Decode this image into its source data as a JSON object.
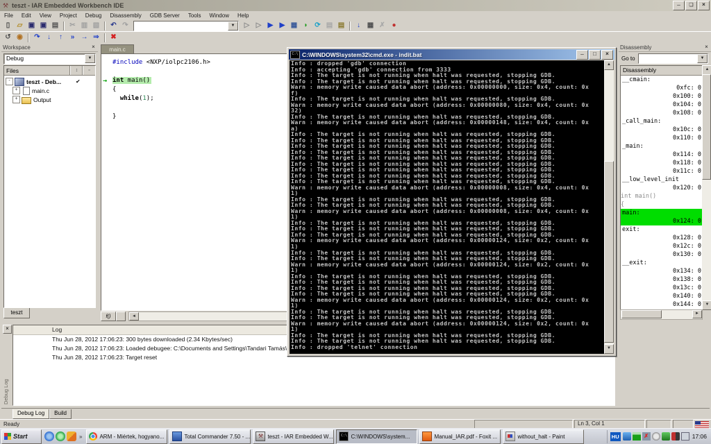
{
  "ide": {
    "title": "teszt - IAR Embedded Workbench IDE",
    "menus": [
      "File",
      "Edit",
      "View",
      "Project",
      "Debug",
      "Disassembly",
      "GDB Server",
      "Tools",
      "Window",
      "Help"
    ],
    "toolbar_main": [
      {
        "name": "new-file-icon",
        "glyph": "▯",
        "color": "#404040"
      },
      {
        "name": "open-file-icon",
        "glyph": "▱",
        "color": "#b08820"
      },
      {
        "name": "save-icon",
        "glyph": "▣",
        "color": "#2c2c6e"
      },
      {
        "name": "save-all-icon",
        "glyph": "▣",
        "color": "#2c2c6e"
      },
      {
        "name": "print-icon",
        "glyph": "▤",
        "color": "#555555"
      },
      {
        "type": "sep"
      },
      {
        "name": "cut-icon",
        "glyph": "✂",
        "color": "#a0a0a0"
      },
      {
        "name": "copy-icon",
        "glyph": "▥",
        "color": "#a0a0a0"
      },
      {
        "name": "paste-icon",
        "glyph": "▧",
        "color": "#a0a0a0"
      },
      {
        "type": "sep"
      },
      {
        "name": "undo-icon",
        "glyph": "↶",
        "color": "#28388c"
      },
      {
        "name": "redo-icon",
        "glyph": "↷",
        "color": "#a0a0a0"
      },
      {
        "type": "combo",
        "name": "quick-search-combo"
      },
      {
        "name": "nav-back-icon",
        "glyph": "▷",
        "color": "#8a8a8a"
      },
      {
        "name": "nav-forward-icon",
        "glyph": "▷",
        "color": "#8a8a8a"
      },
      {
        "name": "toggle-bookmark-icon",
        "glyph": "▶",
        "color": "#2040c8"
      },
      {
        "name": "go-to-bookmark-icon",
        "glyph": "▶",
        "color": "#2040c8"
      },
      {
        "name": "watch-window-icon",
        "glyph": "▦",
        "color": "#3a5a9a"
      },
      {
        "name": "make-icon",
        "glyph": "◗",
        "color": "#1a9a1a"
      },
      {
        "name": "compile-icon",
        "glyph": "⟳",
        "color": "#18a0c8"
      },
      {
        "name": "stop-build-icon",
        "glyph": "▤",
        "color": "#a8a8a8"
      },
      {
        "name": "build-log-icon",
        "glyph": "▤",
        "color": "#8a7a30"
      },
      {
        "type": "sep"
      },
      {
        "name": "download-icon",
        "glyph": "↓",
        "color": "#2040c8"
      },
      {
        "name": "registers-icon",
        "glyph": "▦",
        "color": "#505050"
      },
      {
        "name": "breakpoint-disabled-icon",
        "glyph": "✗",
        "color": "#a8a8a8"
      },
      {
        "name": "debug-icon",
        "glyph": "●",
        "color": "#c03030"
      }
    ],
    "toolbar_debug": [
      {
        "name": "reset-icon",
        "glyph": "↺",
        "color": "#505050"
      },
      {
        "name": "break-icon",
        "glyph": "◉",
        "color": "#b07020"
      },
      {
        "type": "sep"
      },
      {
        "name": "step-over-icon",
        "glyph": "↷",
        "color": "#2040c8"
      },
      {
        "name": "step-into-icon",
        "glyph": "↓",
        "color": "#2040c8"
      },
      {
        "name": "step-out-icon",
        "glyph": "↑",
        "color": "#2040c8"
      },
      {
        "name": "next-statement-icon",
        "glyph": "»",
        "color": "#2040c8"
      },
      {
        "name": "run-to-cursor-icon",
        "glyph": "→",
        "color": "#2040c8"
      },
      {
        "name": "go-icon",
        "glyph": "⇒",
        "color": "#2040c8"
      },
      {
        "type": "sep"
      },
      {
        "name": "stop-debugging-icon",
        "glyph": "✖",
        "color": "#d42020"
      }
    ],
    "workspace": {
      "title": "Workspace",
      "config": "Debug",
      "files_header": "Files",
      "tree": [
        {
          "label": "teszt - Deb...",
          "icon": "project",
          "expander": "-",
          "level": 0,
          "bold": true,
          "check": "✔"
        },
        {
          "label": "main.c",
          "icon": "file",
          "expander": "+",
          "level": 1
        },
        {
          "label": "Output",
          "icon": "folder",
          "expander": "+",
          "level": 1
        }
      ],
      "bottom_tab": "teszt"
    },
    "editor": {
      "tab": "main.c",
      "fn_label": "f()",
      "lines": [
        {
          "seg": [
            {
              "t": "#include",
              "c": "pre"
            },
            {
              "t": " <NXP/iolpc2106.h>",
              "c": "plain"
            }
          ]
        },
        {
          "seg": []
        },
        {
          "current": true,
          "seg": [
            {
              "t": "int",
              "c": "kw"
            },
            {
              "t": " main()",
              "c": "plain"
            }
          ]
        },
        {
          "seg": [
            {
              "t": "{",
              "c": "plain"
            }
          ]
        },
        {
          "seg": [
            {
              "t": "  ",
              "c": "plain"
            },
            {
              "t": "while",
              "c": "kw"
            },
            {
              "t": "(",
              "c": "plain"
            },
            {
              "t": "1",
              "c": "num"
            },
            {
              "t": ");",
              "c": "plain"
            }
          ]
        },
        {
          "seg": []
        },
        {
          "seg": [
            {
              "t": "}",
              "c": "plain"
            }
          ]
        }
      ]
    },
    "disassembly": {
      "title": "Disassembly",
      "goto_label": "Go to",
      "col_header": "Disassembly",
      "rows": [
        {
          "t": "__cmain:",
          "k": "label"
        },
        {
          "t": "0xfc: 0",
          "k": "addr"
        },
        {
          "t": "0x100: 0",
          "k": "addr"
        },
        {
          "t": "0x104: 0",
          "k": "addr"
        },
        {
          "t": "0x108: 0",
          "k": "addr"
        },
        {
          "t": "_call_main:",
          "k": "label"
        },
        {
          "t": "0x10c: 0",
          "k": "addr"
        },
        {
          "t": "0x110: 0",
          "k": "addr"
        },
        {
          "t": "_main:",
          "k": "label"
        },
        {
          "t": "0x114: 0",
          "k": "addr"
        },
        {
          "t": "0x118: 0",
          "k": "addr"
        },
        {
          "t": "0x11c: 0",
          "k": "addr"
        },
        {
          "t": "__low_level_init",
          "k": "label"
        },
        {
          "t": "0x120: 0",
          "k": "addr"
        },
        {
          "t": "int main()",
          "k": "src"
        },
        {
          "t": "{",
          "k": "src"
        },
        {
          "t": "main:",
          "k": "label cur"
        },
        {
          "t": "0x124: 0",
          "k": "addr cur"
        },
        {
          "t": "exit:",
          "k": "label"
        },
        {
          "t": "0x128: 0",
          "k": "addr"
        },
        {
          "t": "0x12c: 0",
          "k": "addr"
        },
        {
          "t": "0x130: 0",
          "k": "addr"
        },
        {
          "t": "__exit:",
          "k": "label"
        },
        {
          "t": "0x134: 0",
          "k": "addr"
        },
        {
          "t": "0x138: 0",
          "k": "addr"
        },
        {
          "t": "0x13c: 0",
          "k": "addr"
        },
        {
          "t": "0x140: 0",
          "k": "addr"
        },
        {
          "t": "0x144: 0",
          "k": "addr"
        }
      ]
    },
    "log": {
      "header": "Log",
      "side_label": "Debug Log",
      "entries": [
        "Thu Jun 28, 2012 17:06:23: 300 bytes downloaded (2.34 Kbytes/sec)",
        "Thu Jun 28, 2012 17:06:23: Loaded debugee: C:\\Documents and Settings\\Tandari Tamás\\",
        "Thu Jun 28, 2012 17:06:23: Target reset"
      ],
      "tabs": [
        {
          "label": "Debug Log",
          "active": true
        },
        {
          "label": "Build",
          "active": false
        }
      ]
    },
    "statusbar": {
      "ready": "Ready",
      "position": "Ln 3, Col 1"
    }
  },
  "cmd": {
    "title": "C:\\WINDOWS\\system32\\cmd.exe - indit.bat",
    "lines": [
      "Info : dropped 'gdb' connection",
      "Info : accepting 'gdb' connection from 3333",
      "Info : The target is not running when halt was requested, stopping GDB.",
      "Info : The target is not running when halt was requested, stopping GDB.",
      "Warn : memory write caused data abort (address: 0x00000000, size: 0x4, count: 0x",
      "f)",
      "Info : The target is not running when halt was requested, stopping GDB.",
      "Warn : memory write caused data abort (address: 0x00000080, size: 0x4, count: 0x",
      "32)",
      "Info : The target is not running when halt was requested, stopping GDB.",
      "Warn : memory write caused data abort (address: 0x00000148, size: 0x4, count: 0x",
      "a)",
      "Info : The target is not running when halt was requested, stopping GDB.",
      "Info : The target is not running when halt was requested, stopping GDB.",
      "Info : The target is not running when halt was requested, stopping GDB.",
      "Info : The target is not running when halt was requested, stopping GDB.",
      "Info : The target is not running when halt was requested, stopping GDB.",
      "Info : The target is not running when halt was requested, stopping GDB.",
      "Info : The target is not running when halt was requested, stopping GDB.",
      "Info : The target is not running when halt was requested, stopping GDB.",
      "Info : The target is not running when halt was requested, stopping GDB.",
      "Warn : memory write caused data abort (address: 0x00000008, size: 0x4, count: 0x",
      "1)",
      "Info : The target is not running when halt was requested, stopping GDB.",
      "Info : The target is not running when halt was requested, stopping GDB.",
      "Warn : memory write caused data abort (address: 0x00000008, size: 0x4, count: 0x",
      "1)",
      "Info : The target is not running when halt was requested, stopping GDB.",
      "Info : The target is not running when halt was requested, stopping GDB.",
      "Info : The target is not running when halt was requested, stopping GDB.",
      "Warn : memory write caused data abort (address: 0x00000124, size: 0x2, count: 0x",
      "1)",
      "Info : The target is not running when halt was requested, stopping GDB.",
      "Info : The target is not running when halt was requested, stopping GDB.",
      "Warn : memory write caused data abort (address: 0x00000124, size: 0x2, count: 0x",
      "1)",
      "Info : The target is not running when halt was requested, stopping GDB.",
      "Info : The target is not running when halt was requested, stopping GDB.",
      "Info : The target is not running when halt was requested, stopping GDB.",
      "Info : The target is not running when halt was requested, stopping GDB.",
      "Warn : memory write caused data abort (address: 0x00000124, size: 0x2, count: 0x",
      "1)",
      "Info : The target is not running when halt was requested, stopping GDB.",
      "Info : The target is not running when halt was requested, stopping GDB.",
      "Warn : memory write caused data abort (address: 0x00000124, size: 0x2, count: 0x",
      "1)",
      "Info : The target is not running when halt was requested, stopping GDB.",
      "Info : The target is not running when halt was requested, stopping GDB.",
      "Info : dropped 'telnet' connection"
    ]
  },
  "taskbar": {
    "start_label": "Start",
    "tasks": [
      {
        "label": "ARM - Miértek, hogyano...",
        "icon": "chrome"
      },
      {
        "label": "Total Commander 7.50 - ...",
        "icon": "tc"
      },
      {
        "label": "teszt - IAR Embedded W...",
        "icon": "iar"
      },
      {
        "label": "C:\\WINDOWS\\system...",
        "icon": "cmd",
        "active": true
      },
      {
        "label": "Manual_IAR.pdf - Foxit ...",
        "icon": "foxit"
      },
      {
        "label": "without_halt - Paint",
        "icon": "paint"
      }
    ],
    "tray_lang": "HU",
    "clock": "17:06"
  },
  "colors": {
    "desktop_chrome": "#d4d0c8",
    "active_title_start": "#0a246a",
    "active_title_end": "#a6caf0",
    "console_bg": "#000000",
    "console_text": "#c6c6c6",
    "exec_highlight": "#b4ecac",
    "disasm_current": "#00dd00"
  }
}
